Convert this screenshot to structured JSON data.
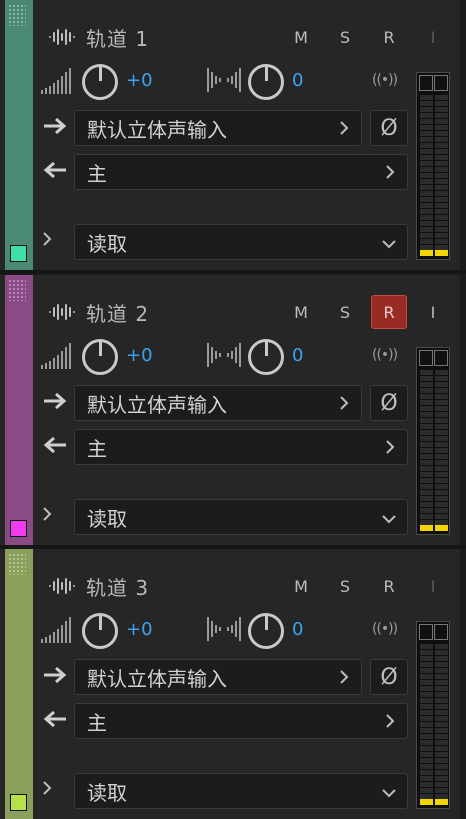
{
  "colors": {
    "value_accent": "#3aa4f0",
    "armed_red": "#9a2a24",
    "meter_yellow": "#f2d600"
  },
  "tracks": [
    {
      "name": "轨道 1",
      "strip_color": "#4a8a74",
      "swatch_color": "#3de0a8",
      "buttons": {
        "mute": "M",
        "solo": "S",
        "record": "R",
        "input": "I"
      },
      "record_armed": false,
      "input_monitor_active": false,
      "volume": "+0",
      "pan": "0",
      "input": "默认立体声输入",
      "output": "主",
      "automation": "读取",
      "meter_level": 0.03
    },
    {
      "name": "轨道 2",
      "strip_color": "#8a4a86",
      "swatch_color": "#f03cf0",
      "buttons": {
        "mute": "M",
        "solo": "S",
        "record": "R",
        "input": "I"
      },
      "record_armed": true,
      "input_monitor_active": true,
      "volume": "+0",
      "pan": "0",
      "input": "默认立体声输入",
      "output": "主",
      "automation": "读取",
      "meter_level": 0.03
    },
    {
      "name": "轨道 3",
      "strip_color": "#8aa05a",
      "swatch_color": "#b8e04a",
      "buttons": {
        "mute": "M",
        "solo": "S",
        "record": "R",
        "input": "I"
      },
      "record_armed": false,
      "input_monitor_active": false,
      "volume": "+0",
      "pan": "0",
      "input": "默认立体声输入",
      "output": "主",
      "automation": "读取",
      "meter_level": 0.03
    }
  ],
  "icons": {
    "waveform": "waveform-icon",
    "volume": "volume-bars-icon",
    "pan": "stereo-pan-icon",
    "monitor": "monitor-input-icon",
    "phase": "phase-invert-icon",
    "input_arrow": "arrow-right-icon",
    "output_arrow": "arrow-left-icon",
    "expand": "chevron-right-icon",
    "dropdown": "chevron-down-icon"
  },
  "monitor_glyph": "((•))",
  "phase_glyph": "Ø"
}
